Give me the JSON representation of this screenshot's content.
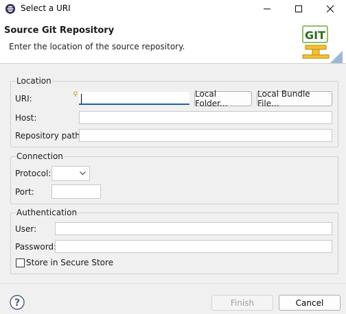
{
  "window": {
    "title": "Select a URI",
    "minimize_icon": "minimize-icon",
    "maximize_icon": "maximize-icon",
    "close_icon": "close-icon"
  },
  "header": {
    "title": "Source Git Repository",
    "description": "Enter the location of the source repository.",
    "logo_text": "GIT"
  },
  "location": {
    "group_title": "Location",
    "uri_label": "URI:",
    "uri_value": "",
    "local_folder_button": "Local Folder...",
    "local_bundle_button": "Local Bundle File...",
    "host_label": "Host:",
    "host_value": "",
    "repo_path_label": "Repository path:",
    "repo_path_value": ""
  },
  "connection": {
    "group_title": "Connection",
    "protocol_label": "Protocol:",
    "protocol_value": "",
    "port_label": "Port:",
    "port_value": ""
  },
  "authentication": {
    "group_title": "Authentication",
    "user_label": "User:",
    "user_value": "",
    "password_label": "Password:",
    "password_value": "",
    "store_label": "Store in Secure Store",
    "store_checked": false
  },
  "footer": {
    "help_icon": "help-icon",
    "finish_label": "Finish",
    "cancel_label": "Cancel"
  },
  "colors": {
    "focus_accent": "#1f5fa8",
    "disabled_text": "#a0a0a0",
    "logo_green": "#2e8b1e"
  }
}
